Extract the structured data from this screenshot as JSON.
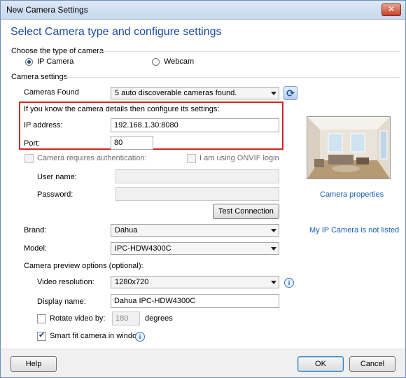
{
  "window": {
    "title": "New Camera Settings",
    "close_glyph": "✕"
  },
  "heading": "Select Camera type and configure settings",
  "camera_type": {
    "group_label": "Choose the type of camera",
    "ip_camera_label": "IP Camera",
    "webcam_label": "Webcam",
    "selected": "IP Camera"
  },
  "camera_settings": {
    "group_label": "Camera settings",
    "cameras_found_label": "Cameras Found",
    "cameras_found_value": "5 auto discoverable cameras found.",
    "known_details_text": "If you know the camera details then configure its settings:",
    "ip_address_label": "IP address:",
    "ip_address_value": "192.168.1.30:8080",
    "port_label": "Port:",
    "port_value": "80",
    "auth_label": "Camera requires authentication:",
    "onvif_label": "I am using ONVIF login",
    "username_label": "User name:",
    "username_value": "",
    "password_label": "Password:",
    "password_value": "",
    "test_connection_label": "Test Connection",
    "camera_properties_link": "Camera properties",
    "brand_label": "Brand:",
    "brand_value": "Dahua",
    "not_listed_link": "My IP Camera is not listed",
    "model_label": "Model:",
    "model_value": "IPC-HDW4300C"
  },
  "preview_options": {
    "group_label": "Camera preview options (optional):",
    "video_resolution_label": "Video resolution:",
    "video_resolution_value": "1280x720",
    "display_name_label": "Display name:",
    "display_name_value": "Dahua IPC-HDW4300C",
    "rotate_label": "Rotate video by:",
    "rotate_value": "180",
    "degrees_label": "degrees",
    "smart_fit_label": "Smart fit camera in window",
    "smart_fit_checked": true
  },
  "footer": {
    "help_label": "Help",
    "ok_label": "OK",
    "cancel_label": "Cancel"
  },
  "icons": {
    "refresh": "refresh-icon",
    "info": "info-icon"
  },
  "colors": {
    "heading": "#1e4aa8",
    "highlight_box": "#d32626",
    "link": "#1a5fb4"
  }
}
